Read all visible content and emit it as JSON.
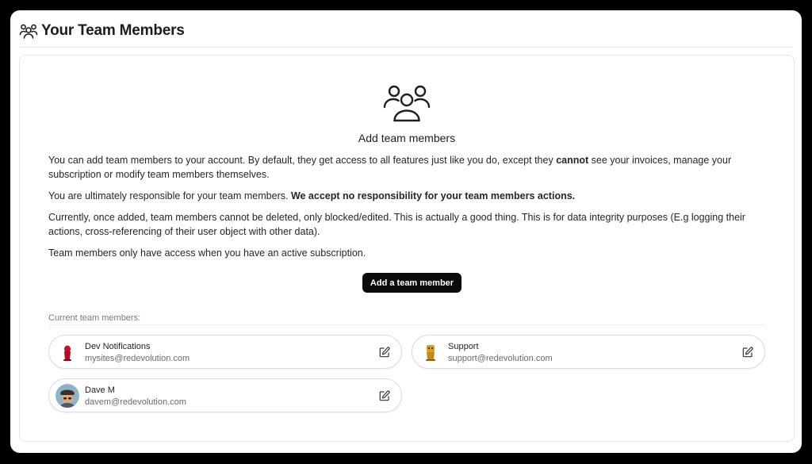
{
  "header": {
    "title": "Your Team Members",
    "icon": "users-icon"
  },
  "intro": {
    "icon": "users-icon",
    "title": "Add team members",
    "p1_before": "You can add team members to your account. By default, they get access to all features just like you do, except they ",
    "p1_bold": "cannot",
    "p1_after": " see your invoices, manage your subscription or modify team members themselves.",
    "p2_before": "You are ultimately responsible for your team members. ",
    "p2_bold": "We accept no responsibility for your team members actions.",
    "p3": "Currently, once added, team members cannot be deleted, only blocked/edited. This is actually a good thing. This is for data integrity purposes (E.g logging their actions, cross-referencing of their user object with other data).",
    "p4": "Team members only have access when you have an active subscription."
  },
  "add_button_label": "Add a team member",
  "members_label": "Current team members:",
  "members": [
    {
      "name": "Dev Notifications",
      "email": "mysites@redevolution.com",
      "avatar": "red-figure-avatar"
    },
    {
      "name": "Support",
      "email": "support@redevolution.com",
      "avatar": "gold-figure-avatar"
    },
    {
      "name": "Dave M",
      "email": "davem@redevolution.com",
      "avatar": "photo-avatar"
    }
  ],
  "colors": {
    "background": "#000000",
    "button": "#0b0b0b",
    "border": "#dcdcdc"
  }
}
